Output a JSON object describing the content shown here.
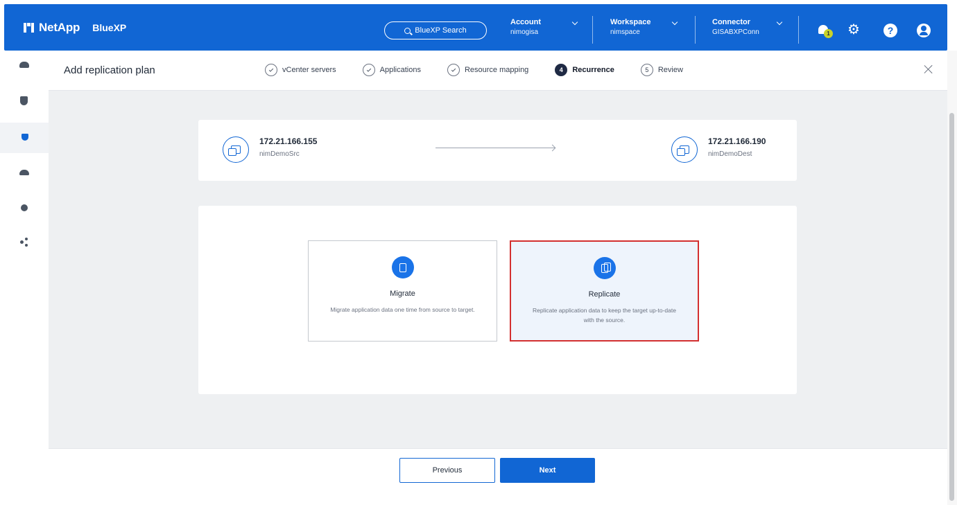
{
  "header": {
    "brand_name": "NetApp",
    "product_name": "BlueXP",
    "search_label": "BlueXP Search",
    "account": {
      "label": "Account",
      "value": "nimogisa"
    },
    "workspace": {
      "label": "Workspace",
      "value": "nimspace"
    },
    "connector": {
      "label": "Connector",
      "value": "GISABXPConn"
    },
    "notification_count": "1",
    "help_symbol": "?",
    "accent_color": "#1166d4"
  },
  "rail": {
    "items": [
      "storage-icon",
      "shield-icon",
      "protection-icon",
      "cloud-sync-icon",
      "health-icon",
      "share-icon"
    ],
    "active_index": 2
  },
  "wizard": {
    "title": "Add replication plan",
    "steps": [
      {
        "label": "vCenter servers",
        "state": "done"
      },
      {
        "label": "Applications",
        "state": "done"
      },
      {
        "label": "Resource mapping",
        "state": "done"
      },
      {
        "label": "Recurrence",
        "state": "current",
        "number": "4"
      },
      {
        "label": "Review",
        "state": "pending",
        "number": "5"
      }
    ]
  },
  "source": {
    "ip": "172.21.166.155",
    "name": "nimDemoSrc"
  },
  "destination": {
    "ip": "172.21.166.190",
    "name": "nimDemoDest"
  },
  "options": [
    {
      "title": "Migrate",
      "description": "Migrate application data one time from source to target.",
      "selected": false
    },
    {
      "title": "Replicate",
      "description": "Replicate application data to keep the target up-to-date with the source.",
      "selected": true
    }
  ],
  "footer": {
    "previous_label": "Previous",
    "next_label": "Next"
  }
}
